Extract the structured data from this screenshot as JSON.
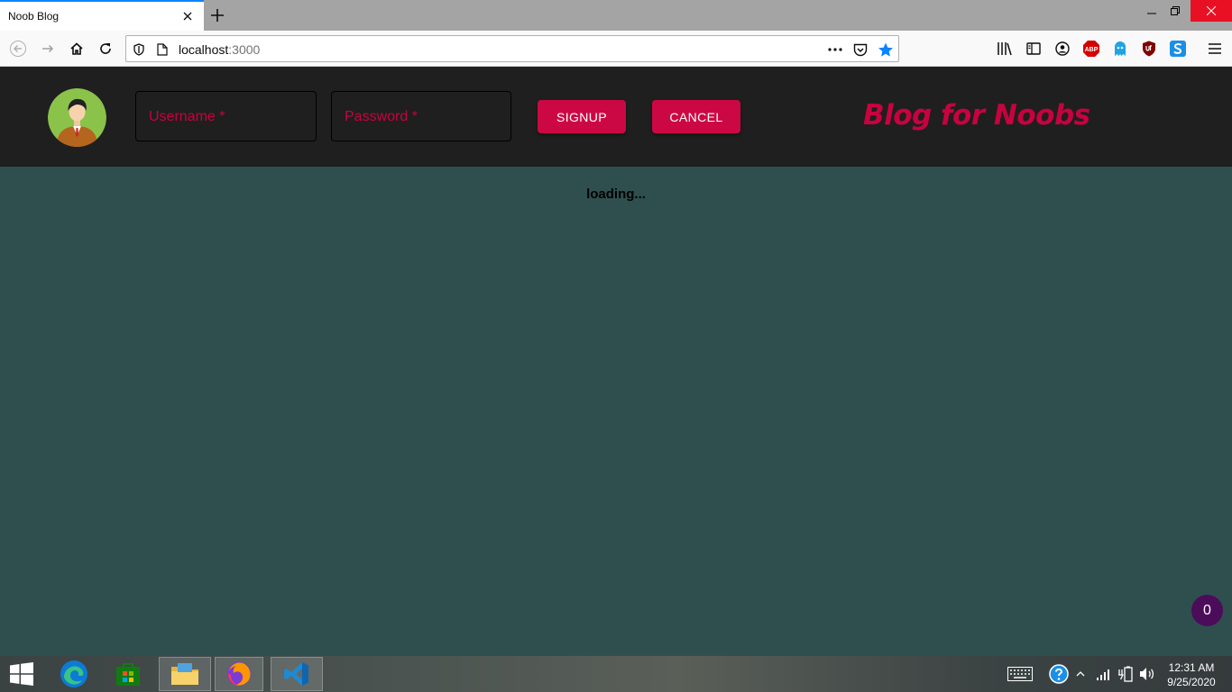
{
  "browser": {
    "tab_title": "Noob Blog",
    "url_host": "localhost",
    "url_port": ":3000",
    "abp_badge": "ABP"
  },
  "header": {
    "username_label": "Username *",
    "password_label": "Password *",
    "signup_label": "SIGNUP",
    "cancel_label": "CANCEL",
    "brand": "Blog for Noobs"
  },
  "main": {
    "loading_text": "loading..."
  },
  "counter": {
    "value": "0"
  },
  "taskbar": {
    "time": "12:31 AM",
    "date": "9/25/2020"
  },
  "colors": {
    "accent": "#cc0844",
    "header_bg": "#1f1f1f",
    "page_bg": "#2f4f4f",
    "counter_bg": "#4b0c5a"
  }
}
